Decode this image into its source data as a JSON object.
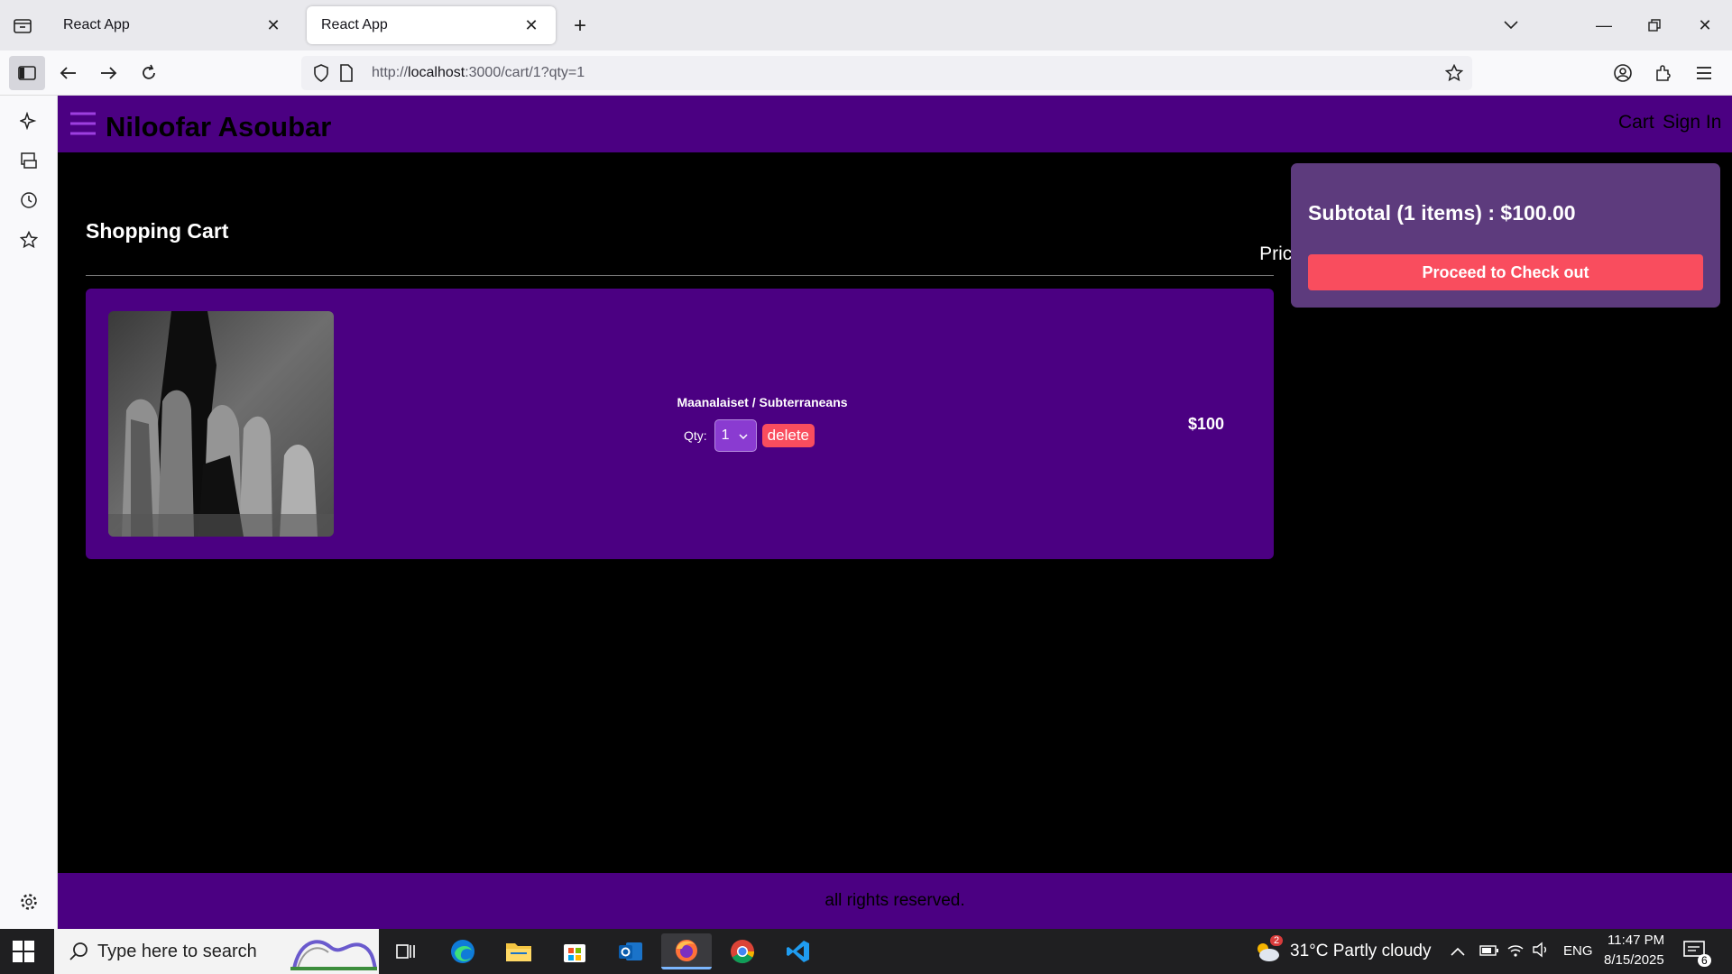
{
  "browser": {
    "tabs": [
      {
        "title": "React App",
        "active": false
      },
      {
        "title": "React App",
        "active": true
      }
    ],
    "url": {
      "prefix": "http://",
      "host": "localhost",
      "rest": ":3000/cart/1?qty=1"
    }
  },
  "app": {
    "brand": "Niloofar Asoubar",
    "nav": {
      "cart": "Cart",
      "signin": "Sign In"
    },
    "cart": {
      "title": "Shopping Cart",
      "price_header": "Price",
      "items": [
        {
          "name": "Maanalaiset / Subterraneans",
          "qty_label": "Qty:",
          "qty": "1",
          "delete_label": "delete",
          "price": "$100"
        }
      ]
    },
    "summary": {
      "subtotal": "Subtotal (1 items) : $100.00",
      "checkout_label": "Proceed to Check out"
    },
    "footer": "all rights reserved."
  },
  "taskbar": {
    "search_placeholder": "Type here to search",
    "weather": "31°C  Partly cloudy",
    "weather_badge": "2",
    "language": "ENG",
    "time": "11:47 PM",
    "date": "8/15/2025",
    "notifications": "6"
  },
  "colors": {
    "header_purple": "#4b0082",
    "summary_purple": "#5d3b7d",
    "accent_red": "#f94d5e"
  }
}
